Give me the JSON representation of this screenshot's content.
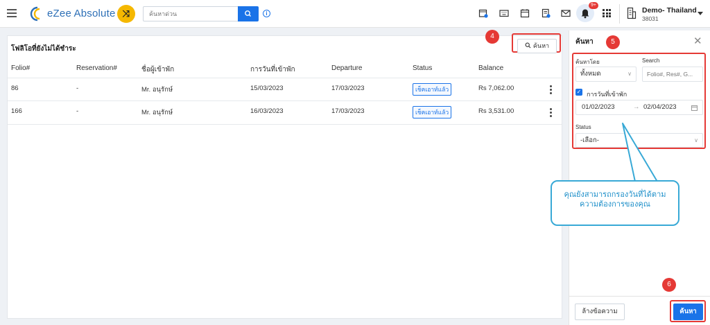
{
  "brand": {
    "name": "eZee Absolute"
  },
  "header": {
    "search_placeholder": "ค้นหาด่วน",
    "notifications_count": "9+",
    "property_name": "Demo- Thailand",
    "property_code": "38031"
  },
  "main": {
    "title": "โฟลิโอที่ยังไม่ได้ชำระ",
    "search_button": "ค้นหา",
    "columns": [
      "Folio#",
      "Reservation#",
      "ชื่อผู้เข้าพัก",
      "การวันที่เข้าพัก",
      "Departure",
      "Status",
      "Balance"
    ],
    "rows": [
      {
        "folio": "86",
        "reservation": "-",
        "guest": "Mr. อนุรักษ์",
        "arrival": "15/03/2023",
        "departure": "17/03/2023",
        "status": "เช็คเอาท์แล้ว",
        "balance": "Rs 7,062.00"
      },
      {
        "folio": "166",
        "reservation": "-",
        "guest": "Mr. อนุรักษ์",
        "arrival": "16/03/2023",
        "departure": "17/03/2023",
        "status": "เช็คเอาท์แล้ว",
        "balance": "Rs 3,531.00"
      }
    ]
  },
  "panel": {
    "title": "ค้นหา",
    "search_by_label": "ค้นหาโดย",
    "search_by_value": "ทั้งหมด",
    "search_label": "Search",
    "search_placeholder": "Folio#, Res#, G...",
    "date_checkbox_label": "การวันที่เข้าพัก",
    "date_from": "01/02/2023",
    "date_to": "02/04/2023",
    "status_label": "Status",
    "status_value": "-เลือก-",
    "clear_button": "ล้างข้อความ",
    "search_button": "ค้นหา"
  },
  "annotations": {
    "step4": "4",
    "step5": "5",
    "step6": "6",
    "tooltip": "คุณยังสามารถกรองวันที่ได้ตามความต้องการของคุณ"
  },
  "colors": {
    "accent": "#1a73e8",
    "callout": "#e53935",
    "tooltip_border": "#38a9d6"
  }
}
